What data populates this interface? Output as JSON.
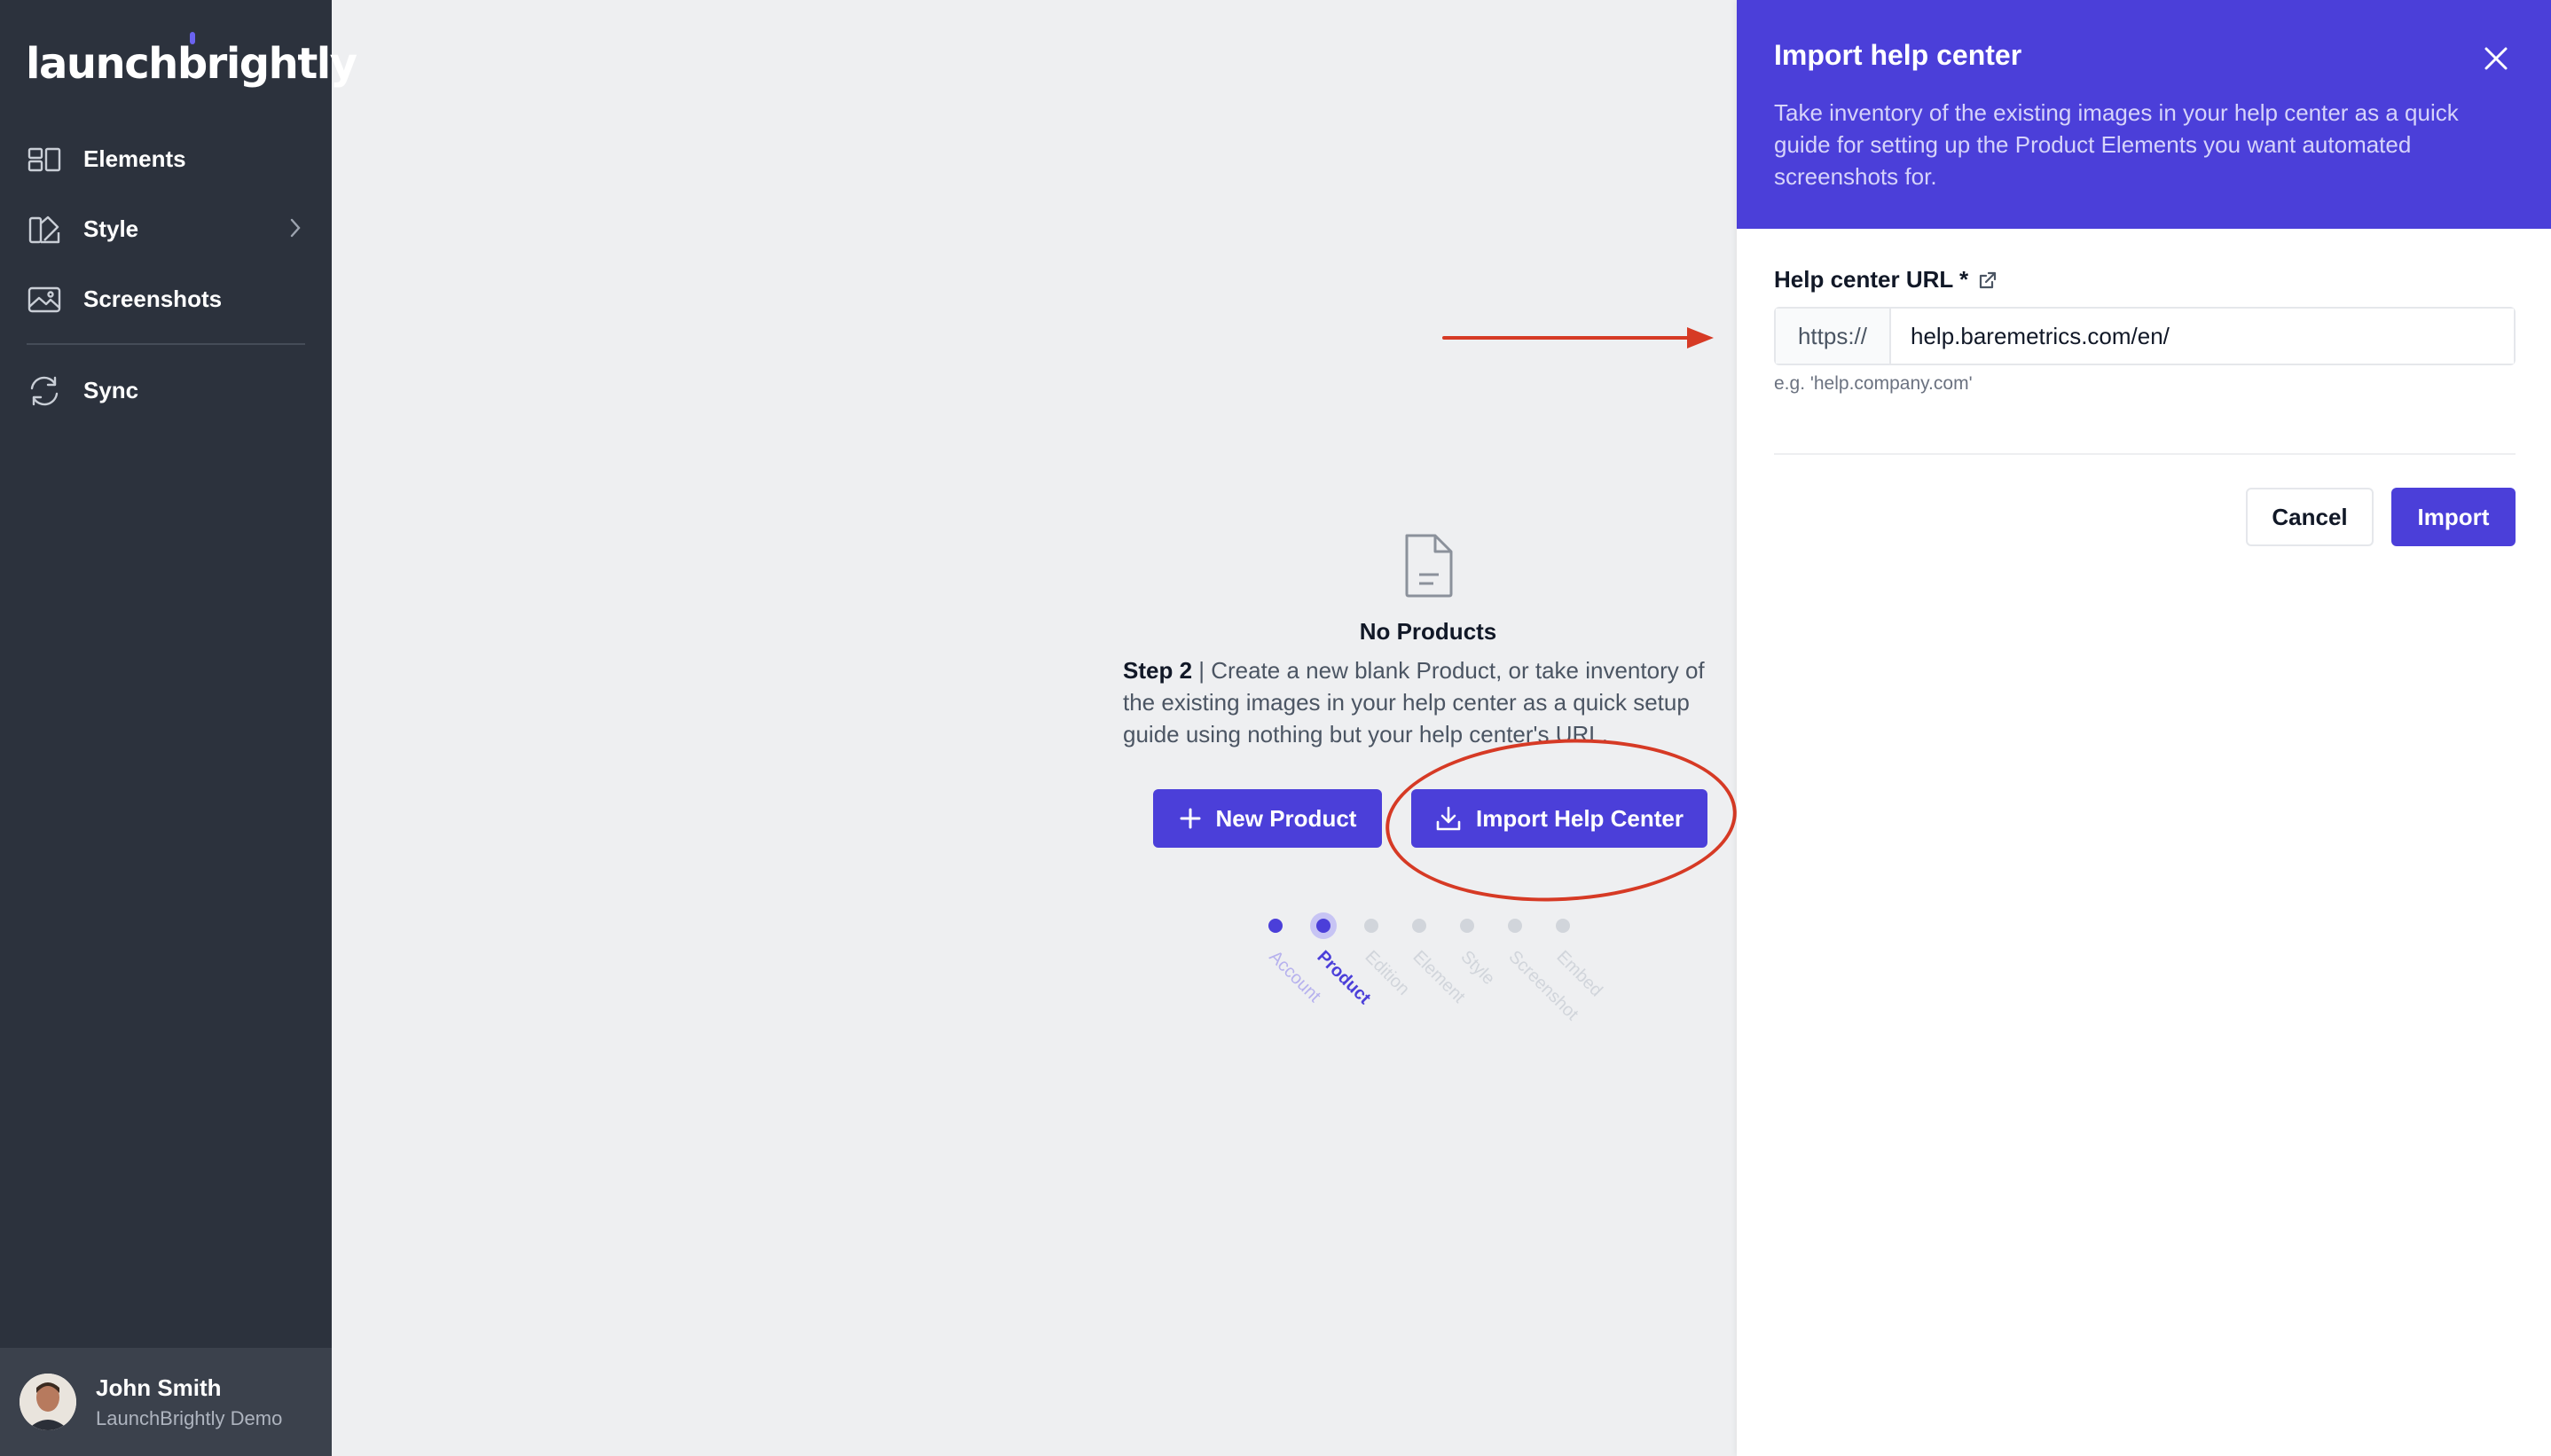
{
  "brand": {
    "logo_text": "launchbrightly",
    "accent": "#4b3fd9",
    "sidebar_bg": "#2c323d"
  },
  "sidebar": {
    "items": [
      {
        "label": "Elements",
        "icon": "elements-icon"
      },
      {
        "label": "Style",
        "icon": "style-icon",
        "has_submenu": true
      },
      {
        "label": "Screenshots",
        "icon": "image-icon"
      },
      {
        "label": "Sync",
        "icon": "sync-icon"
      }
    ],
    "user": {
      "name": "John Smith",
      "org": "LaunchBrightly Demo"
    }
  },
  "main": {
    "empty_title": "No Products",
    "step_prefix": "Step 2",
    "description": " | Create a new blank Product, or take inventory of the existing images in your help center as a quick setup guide using nothing but your help center's URL.",
    "new_product_label": "New Product",
    "import_help_center_label": "Import Help Center",
    "steps": [
      {
        "label": "Account",
        "state": "done"
      },
      {
        "label": "Product",
        "state": "current"
      },
      {
        "label": "Edition",
        "state": "todo"
      },
      {
        "label": "Element",
        "state": "todo"
      },
      {
        "label": "Style",
        "state": "todo"
      },
      {
        "label": "Screenshot",
        "state": "todo"
      },
      {
        "label": "Embed",
        "state": "todo"
      }
    ]
  },
  "panel": {
    "title": "Import help center",
    "description": "Take inventory of the existing images in your help center as a quick guide for setting up the Product Elements you want automated screenshots for.",
    "field_label": "Help center URL *",
    "url_prefix": "https://",
    "url_value": "help.baremetrics.com/en/",
    "url_hint": "e.g. 'help.company.com'",
    "cancel_label": "Cancel",
    "import_label": "Import"
  },
  "annotation_color": "#d63a25"
}
